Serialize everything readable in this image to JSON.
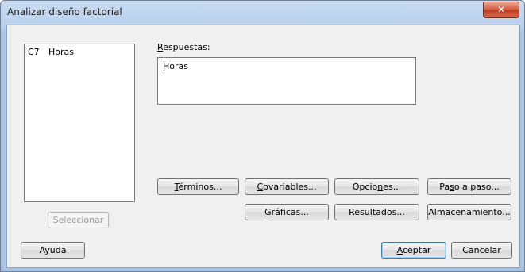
{
  "window": {
    "title": "Analizar diseño factorial",
    "close_glyph": "✕"
  },
  "variable_list": {
    "items": [
      {
        "col": "C7",
        "name": "Horas"
      }
    ]
  },
  "responses": {
    "label_accel": "R",
    "label_rest": "espuestas:",
    "value": "Horas"
  },
  "buttons": {
    "terminos": {
      "pre": "",
      "accel": "T",
      "post": "érminos..."
    },
    "covariables": {
      "pre": "",
      "accel": "C",
      "post": "ovariables..."
    },
    "opciones": {
      "pre": "Opcio",
      "accel": "n",
      "post": "es..."
    },
    "paso_a_paso": {
      "pre": "Pa",
      "accel": "s",
      "post": "o a paso..."
    },
    "graficas": {
      "pre": "",
      "accel": "G",
      "post": "ráficas..."
    },
    "resultados": {
      "pre": "Resu",
      "accel": "l",
      "post": "tados..."
    },
    "almacenamiento": {
      "pre": "Al",
      "accel": "m",
      "post": "acenamiento..."
    },
    "seleccionar": "Seleccionar",
    "ayuda": "Ayuda",
    "aceptar": {
      "pre": "",
      "accel": "A",
      "post": "ceptar"
    },
    "cancelar": "Cancelar"
  }
}
